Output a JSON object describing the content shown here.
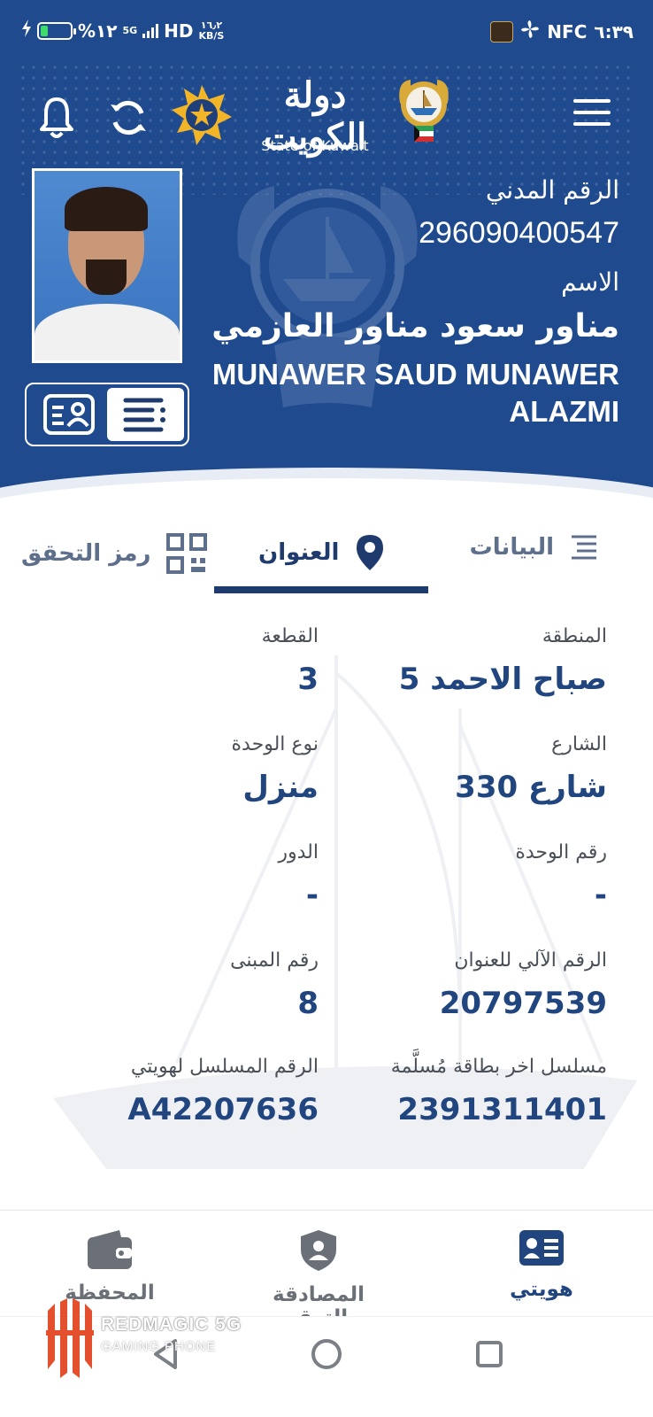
{
  "status_bar": {
    "battery_text": "%١٢",
    "network": "5G",
    "hd": "HD",
    "speed_value": "١٦٫٢",
    "speed_unit": "KB/S",
    "nfc": "NFC",
    "time": "٦:٣٩"
  },
  "header": {
    "logo_ar": "دولة الكويت",
    "logo_en": "State of Kuwait"
  },
  "identity": {
    "civil_id_label": "الرقم المدني",
    "civil_id": "296090400547",
    "name_label": "الاسم",
    "name_ar": "مناور سعود مناور العازمي",
    "name_en": "MUNAWER SAUD MUNAWER ALAZMI"
  },
  "tabs": {
    "data_label": "البيانات",
    "address_label": "العنوان",
    "qr_label": "رمز التحقق",
    "active": "address"
  },
  "address": {
    "area_label": "المنطقة",
    "area_value": "صباح الاحمد 5",
    "block_label": "القطعة",
    "block_value": "3",
    "street_label": "الشارع",
    "street_value": "شارع 330",
    "unit_type_label": "نوع الوحدة",
    "unit_type_value": "منزل",
    "unit_no_label": "رقم الوحدة",
    "unit_no_value": "-",
    "floor_label": "الدور",
    "floor_value": "-",
    "paci_label": "الرقم الآلي للعنوان",
    "paci_value": "20797539",
    "building_label": "رقم المبنى",
    "building_value": "8",
    "last_card_label": "مسلسل اخر بطاقة مُسلَّمة",
    "last_card_value": "2391311401",
    "my_id_serial_label": "الرقم المسلسل لهويتي",
    "my_id_serial_value": "A42207636"
  },
  "bottom_nav": {
    "my_id": "هويتي",
    "auth_sign": "المصادقة والتوقيع",
    "wallet": "المحفظة"
  },
  "watermark": {
    "brand": "REDMAGIC 5G",
    "sub": "GAMING PHONE"
  },
  "colors": {
    "primary": "#1f4a8e",
    "accent_text": "#21467f",
    "muted": "#6b6f77"
  }
}
